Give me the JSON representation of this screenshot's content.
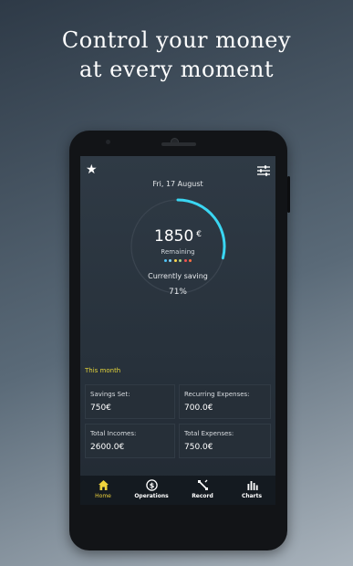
{
  "promo": {
    "line1": "Control your money",
    "line2": "at every moment"
  },
  "header": {
    "date": "Fri, 17 August"
  },
  "gauge": {
    "amount": "1850",
    "currency": "€",
    "remaining_label": "Remaining",
    "saving_label": "Currently saving",
    "saving_percent": "71%",
    "progress": 0.29,
    "accent_color": "#3ad6f2",
    "track_color": "#3b4550",
    "dot_colors": [
      "#4fc3f7",
      "#81d4fa",
      "#ffd54f",
      "#aed581",
      "#ef5350",
      "#ff7043"
    ]
  },
  "summary": {
    "title": "This month",
    "cards": [
      {
        "label": "Savings Set:",
        "value": "750€"
      },
      {
        "label": "Recurring Expenses:",
        "value": "700.0€"
      },
      {
        "label": "Total Incomes:",
        "value": "2600.0€"
      },
      {
        "label": "Total Expenses:",
        "value": "750.0€"
      }
    ]
  },
  "nav": {
    "active_color": "#f0d43c",
    "items": [
      {
        "label": "Home",
        "icon": "home-icon"
      },
      {
        "label": "Operations",
        "icon": "dollar-icon"
      },
      {
        "label": "Record",
        "icon": "record-icon"
      },
      {
        "label": "Charts",
        "icon": "chart-icon"
      }
    ]
  }
}
